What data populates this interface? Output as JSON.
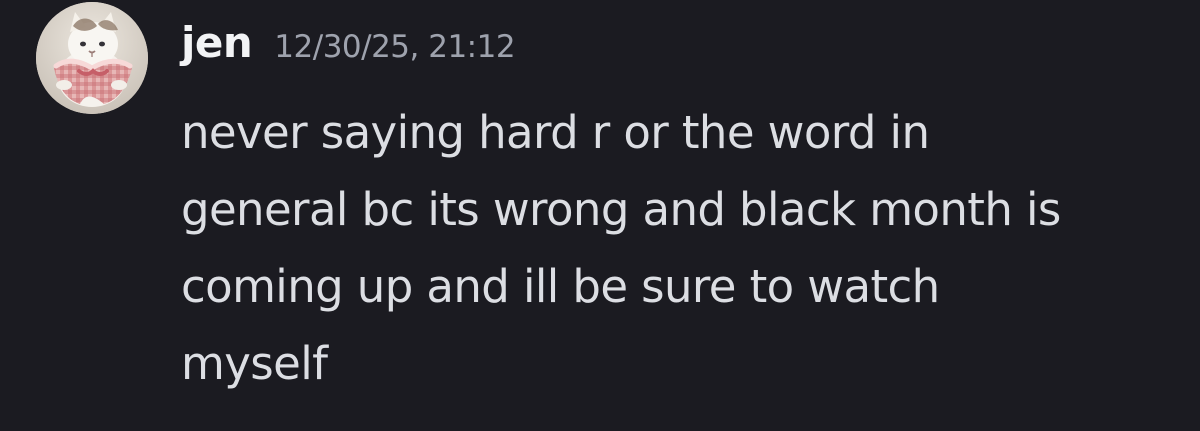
{
  "message": {
    "avatar": {
      "icon": "cat-avatar-icon",
      "description_colors": {
        "fur": "#f1ede6",
        "patch": "#9a8470",
        "dress": "#d98a8d",
        "background": "#d7d0c7"
      }
    },
    "username": "jen",
    "timestamp": "12/30/25, 21:12",
    "lines": [
      "never saying hard r or the word in",
      "general bc its wrong and black month is",
      "coming up and ill be sure to watch",
      "myself"
    ]
  },
  "colors": {
    "background": "#1b1b21",
    "username": "#f2f3f5",
    "timestamp": "#9ea2ad",
    "text": "#dcdee3"
  }
}
